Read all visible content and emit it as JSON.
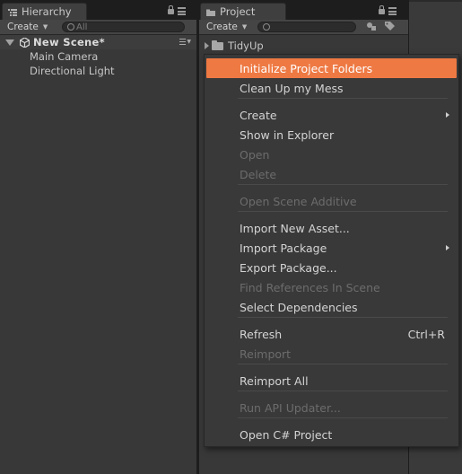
{
  "hierarchy": {
    "tab_label": "Hierarchy",
    "create_label": "Create",
    "search_placeholder": "All",
    "scene_name": "New Scene*",
    "objects": [
      {
        "label": "Main Camera"
      },
      {
        "label": "Directional Light"
      }
    ]
  },
  "project": {
    "tab_label": "Project",
    "create_label": "Create",
    "folder_name": "TidyUp"
  },
  "context_menu": {
    "items": [
      {
        "label": "Initialize Project Folders",
        "highlighted": true
      },
      {
        "label": "Clean Up my Mess"
      },
      {
        "label": "Create",
        "submenu": true
      },
      {
        "label": "Show in Explorer"
      },
      {
        "label": "Open",
        "disabled": true
      },
      {
        "label": "Delete",
        "disabled": true
      },
      {
        "label": "Open Scene Additive",
        "disabled": true
      },
      {
        "label": "Import New Asset..."
      },
      {
        "label": "Import Package",
        "submenu": true
      },
      {
        "label": "Export Package..."
      },
      {
        "label": "Find References In Scene",
        "disabled": true
      },
      {
        "label": "Select Dependencies"
      },
      {
        "label": "Refresh",
        "shortcut": "Ctrl+R"
      },
      {
        "label": "Reimport",
        "disabled": true
      },
      {
        "label": "Reimport All"
      },
      {
        "label": "Run API Updater...",
        "disabled": true
      },
      {
        "label": "Open C# Project"
      }
    ]
  },
  "colors": {
    "highlight": "#ee7943",
    "panel_bg": "#383838",
    "menu_bg": "#393939",
    "disabled_text": "#6c6c6c"
  }
}
